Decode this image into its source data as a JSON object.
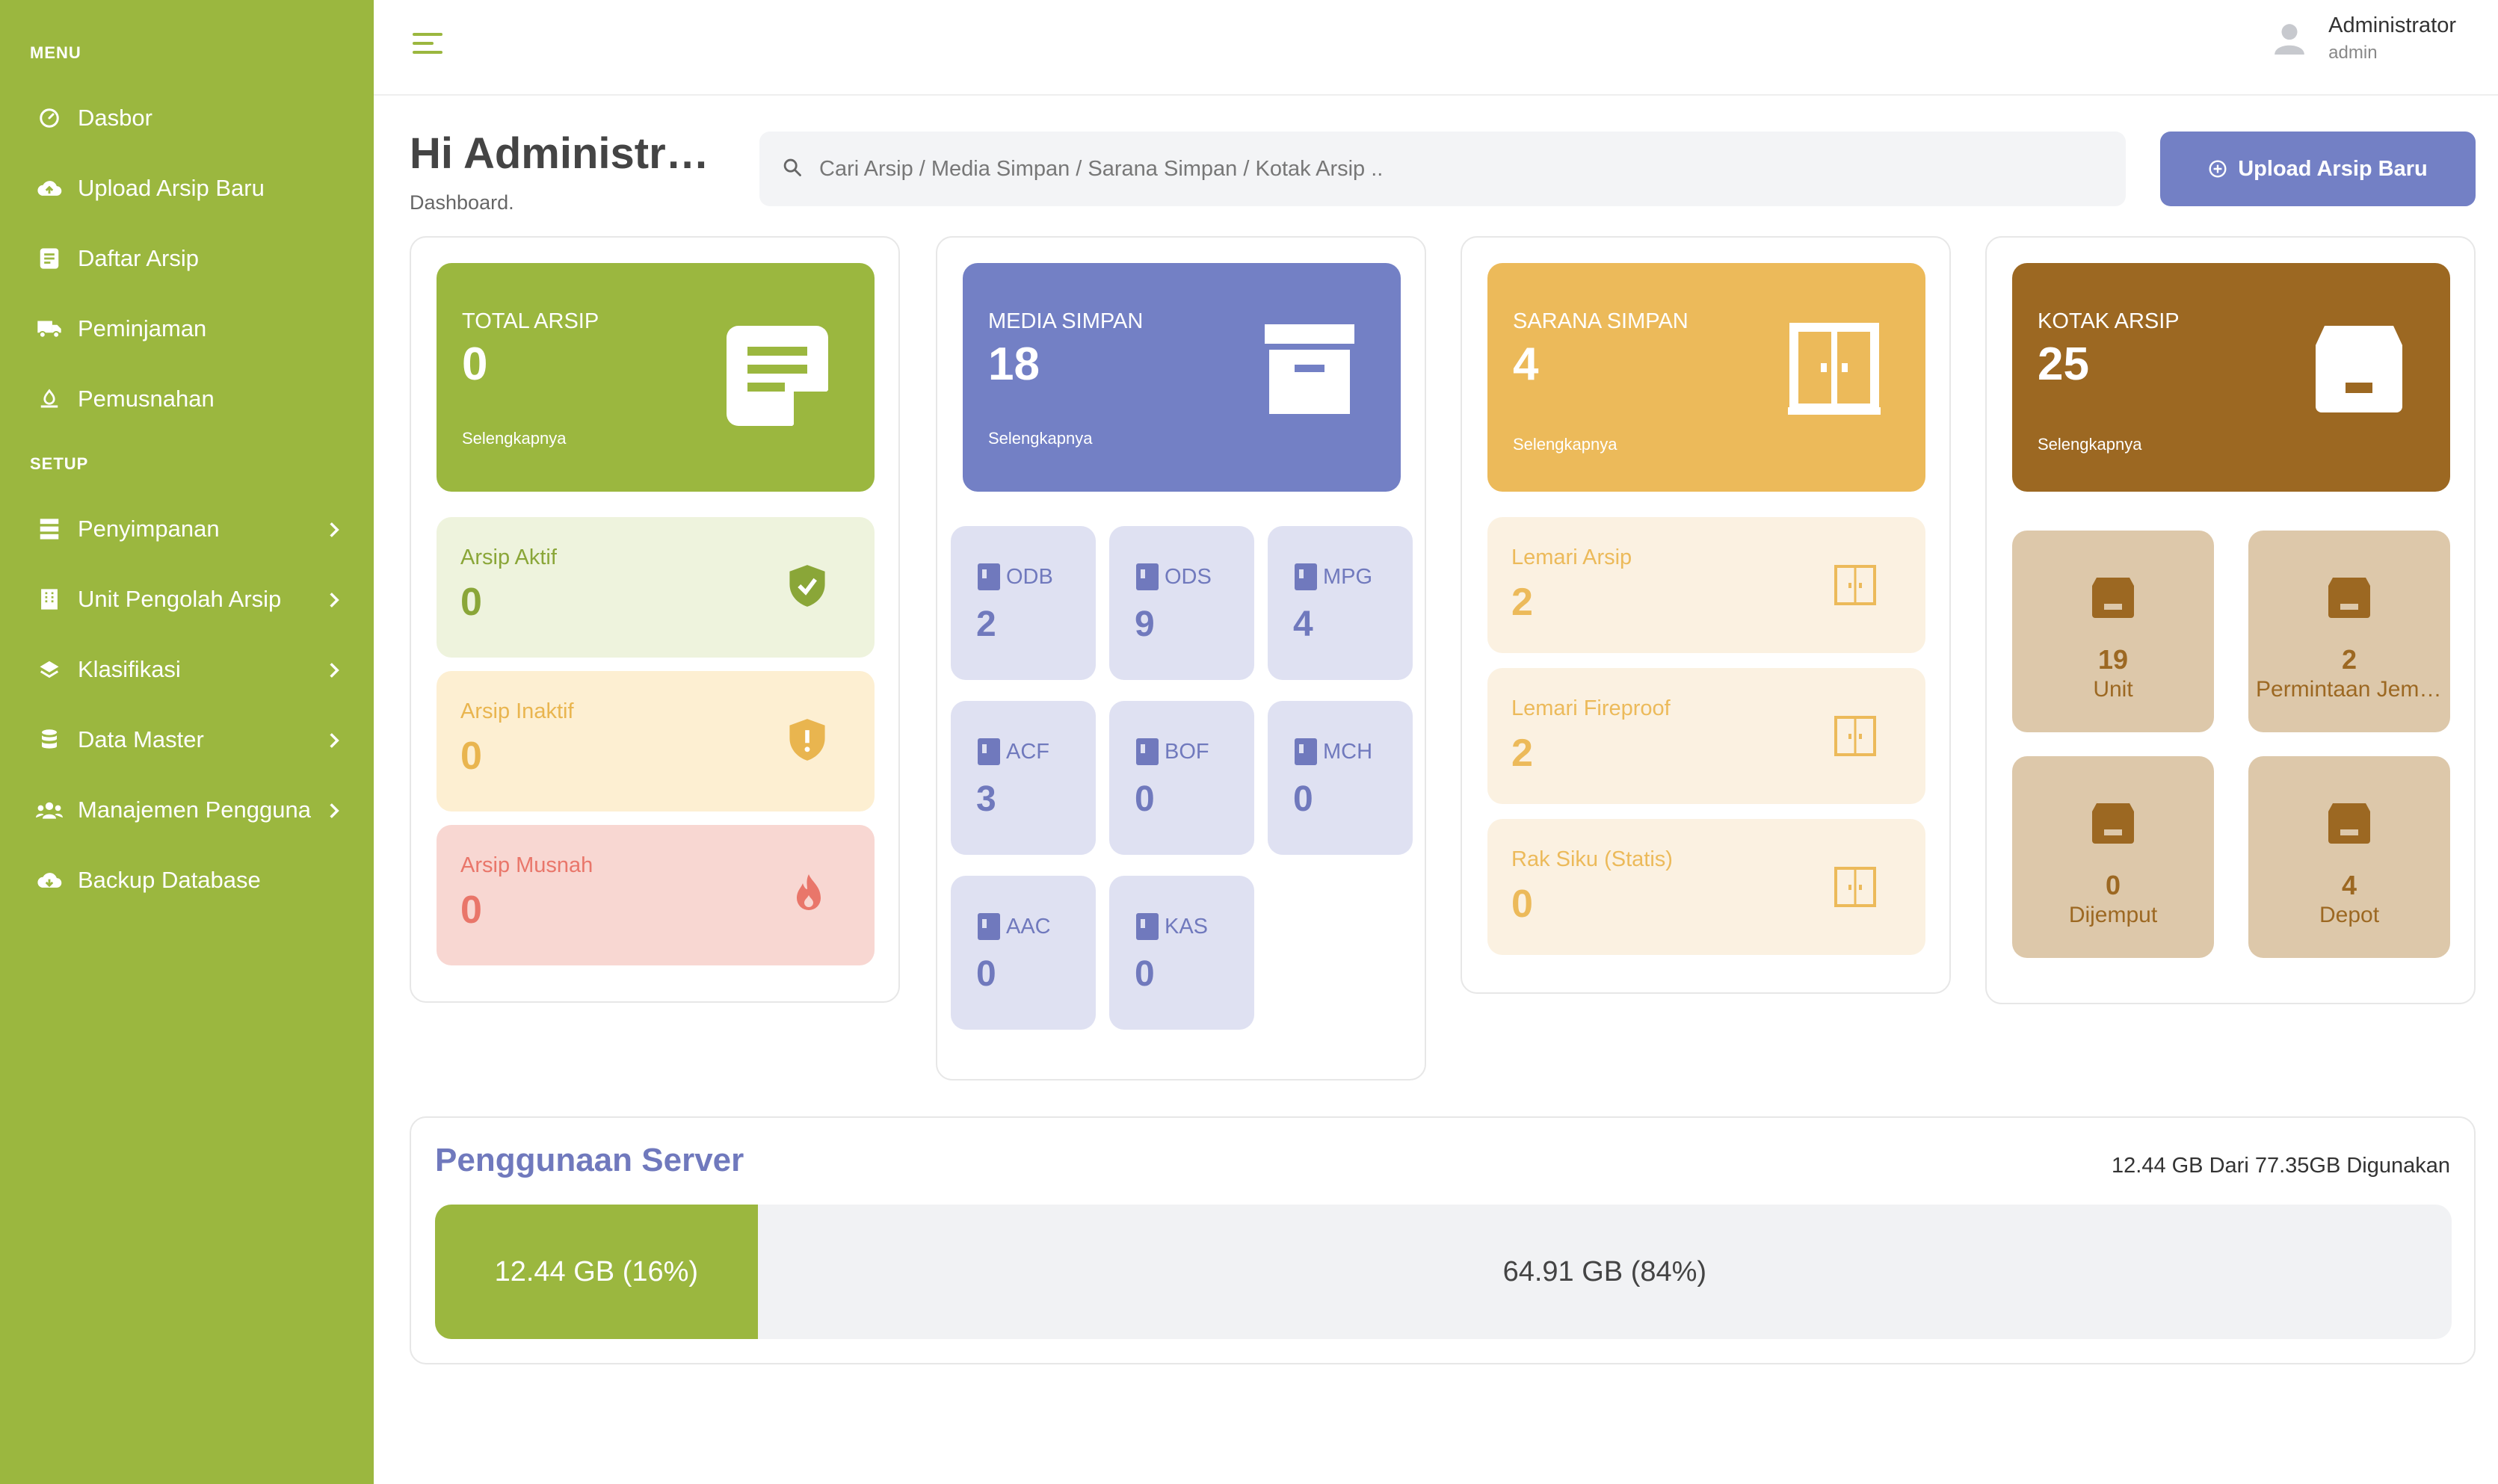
{
  "sidebar": {
    "menu_heading": "MENU",
    "setup_heading": "SETUP",
    "items": [
      {
        "label": "Dasbor",
        "icon": "dashboard-icon"
      },
      {
        "label": "Upload Arsip Baru",
        "icon": "cloud-upload-icon"
      },
      {
        "label": "Daftar Arsip",
        "icon": "document-list-icon"
      },
      {
        "label": "Peminjaman",
        "icon": "truck-icon"
      },
      {
        "label": "Pemusnahan",
        "icon": "recycle-icon"
      }
    ],
    "setup_items": [
      {
        "label": "Penyimpanan",
        "icon": "server-icon"
      },
      {
        "label": "Unit Pengolah Arsip",
        "icon": "building-icon"
      },
      {
        "label": "Klasifikasi",
        "icon": "layers-icon"
      },
      {
        "label": "Data Master",
        "icon": "database-icon"
      },
      {
        "label": "Manajemen Pengguna",
        "icon": "users-icon"
      },
      {
        "label": "Backup Database",
        "icon": "cloud-download-icon"
      }
    ]
  },
  "topbar": {
    "user_name": "Administrator",
    "user_role": "admin"
  },
  "header": {
    "title": "Hi Administrator",
    "subtitle": "Dashboard.",
    "search_placeholder": "Cari Arsip / Media Simpan / Sarana Simpan / Kotak Arsip ..",
    "upload_label": "Upload Arsip Baru"
  },
  "colors": {
    "green": "#9bb73f",
    "blue": "#7380c5",
    "yellow": "#ecba5a",
    "brown": "#9c6822"
  },
  "total_arsip": {
    "label": "TOTAL ARSIP",
    "value": "0",
    "more": "Selengkapnya",
    "stats": [
      {
        "label": "Arsip Aktif",
        "value": "0",
        "icon": "shield-check-icon"
      },
      {
        "label": "Arsip Inaktif",
        "value": "0",
        "icon": "shield-alert-icon"
      },
      {
        "label": "Arsip Musnah",
        "value": "0",
        "icon": "fire-icon"
      }
    ]
  },
  "media_simpan": {
    "label": "MEDIA SIMPAN",
    "value": "18",
    "more": "Selengkapnya",
    "tiles": [
      {
        "label": "ODB",
        "value": "2"
      },
      {
        "label": "ODS",
        "value": "9"
      },
      {
        "label": "MPG",
        "value": "4"
      },
      {
        "label": "ACF",
        "value": "3"
      },
      {
        "label": "BOF",
        "value": "0"
      },
      {
        "label": "MCH",
        "value": "0"
      },
      {
        "label": "AAC",
        "value": "0"
      },
      {
        "label": "KAS",
        "value": "0"
      }
    ]
  },
  "sarana_simpan": {
    "label": "SARANA SIMPAN",
    "value": "4",
    "more": "Selengkapnya",
    "stats": [
      {
        "label": "Lemari Arsip",
        "value": "2"
      },
      {
        "label": "Lemari Fireproof",
        "value": "2"
      },
      {
        "label": "Rak Siku (Statis)",
        "value": "0"
      }
    ]
  },
  "kotak_arsip": {
    "label": "KOTAK ARSIP",
    "value": "25",
    "more": "Selengkapnya",
    "tiles": [
      {
        "label": "Unit",
        "value": "19"
      },
      {
        "label": "Permintaan Jemput",
        "value": "2"
      },
      {
        "label": "Dijemput",
        "value": "0"
      },
      {
        "label": "Depot",
        "value": "4"
      }
    ]
  },
  "server": {
    "title": "Penggunaan Server",
    "summary": "12.44 GB Dari 77.35GB Digunakan",
    "used_label": "12.44 GB (16%)",
    "free_label": "64.91 GB (84%)",
    "used_percent": 16
  }
}
